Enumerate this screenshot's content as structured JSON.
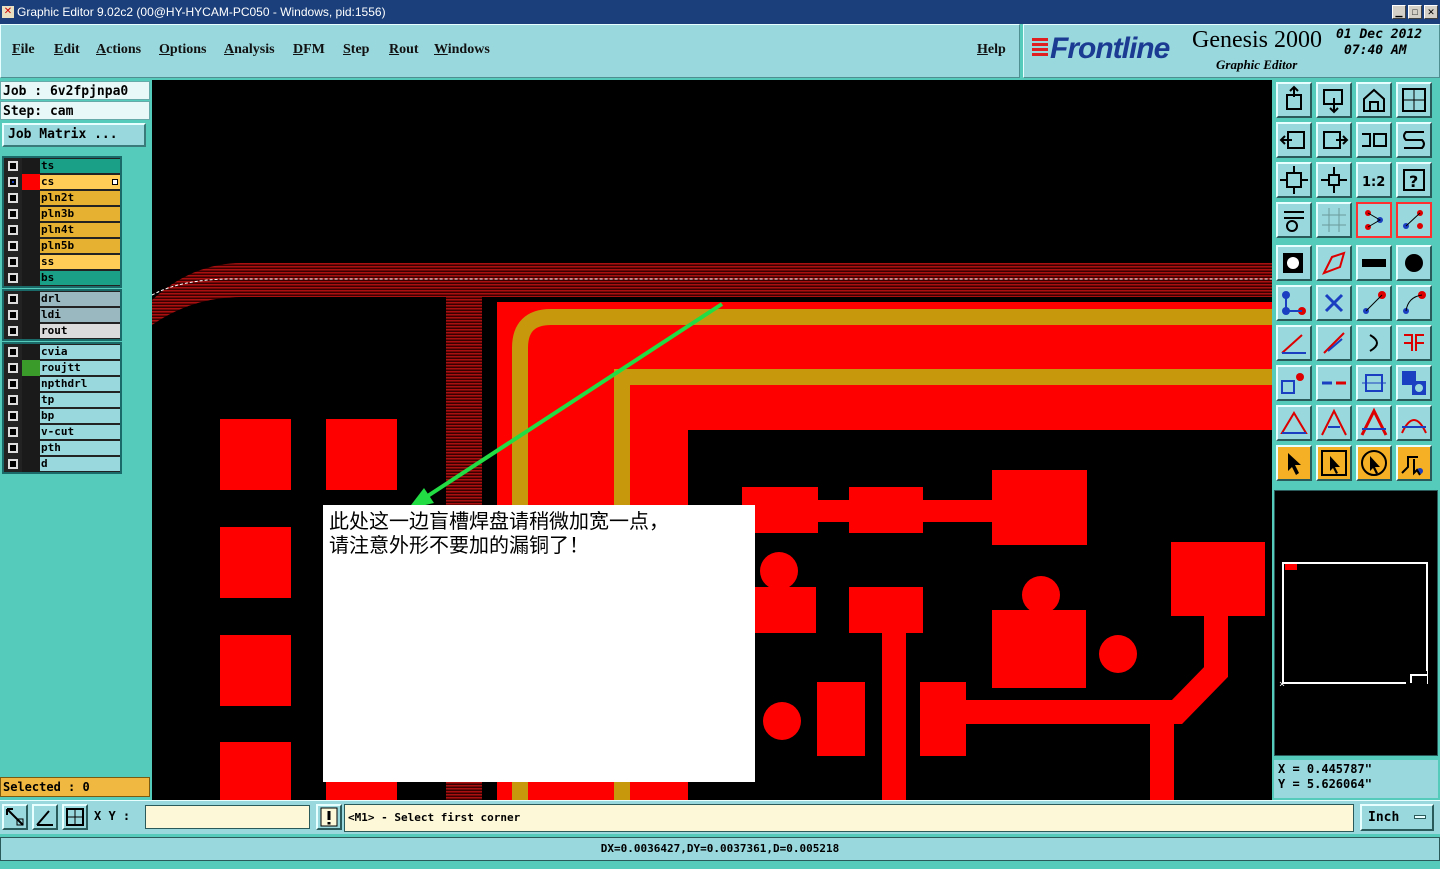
{
  "window": {
    "title": "Graphic Editor 9.02c2 (00@HY-HYCAM-PC050 - Windows, pid:1556)"
  },
  "menu": {
    "file": "File",
    "edit": "Edit",
    "actions": "Actions",
    "options": "Options",
    "analysis": "Analysis",
    "dfm": "DFM",
    "step": "Step",
    "rout": "Rout",
    "windows": "Windows",
    "help": "Help"
  },
  "brand": {
    "logo": "Frontline",
    "product": "Genesis 2000",
    "subtitle": "Graphic Editor",
    "date": "01 Dec 2012",
    "time": "07:40 AM"
  },
  "job": {
    "job_line": "Job : 6v2fpjnpa0",
    "step_line": "Step: cam",
    "matrix_button": "Job Matrix ..."
  },
  "layers": {
    "board": [
      {
        "name": "ts",
        "color": "#1aa087",
        "swatch": "#1a1a1a",
        "checked": false
      },
      {
        "name": "cs",
        "color": "#ffcc55",
        "swatch": "#ff0000",
        "checked": true
      },
      {
        "name": "pln2t",
        "color": "#e6b030",
        "swatch": "#1a1a1a",
        "checked": false
      },
      {
        "name": "pln3b",
        "color": "#e6b030",
        "swatch": "#1a1a1a",
        "checked": false
      },
      {
        "name": "pln4t",
        "color": "#e6b030",
        "swatch": "#1a1a1a",
        "checked": false
      },
      {
        "name": "pln5b",
        "color": "#e6b030",
        "swatch": "#1a1a1a",
        "checked": false
      },
      {
        "name": "ss",
        "color": "#ffcc55",
        "swatch": "#1a1a1a",
        "checked": false
      },
      {
        "name": "bs",
        "color": "#1aa087",
        "swatch": "#1a1a1a",
        "checked": false
      }
    ],
    "drill": [
      {
        "name": "drl",
        "color": "#99b8c0",
        "swatch": "#1a1a1a",
        "checked": false
      },
      {
        "name": "ldi",
        "color": "#99b8c0",
        "swatch": "#1a1a1a",
        "checked": false
      },
      {
        "name": "rout",
        "color": "#dcdcdc",
        "swatch": "#1a1a1a",
        "checked": false
      }
    ],
    "misc": [
      {
        "name": "cvia",
        "color": "#99d8dd",
        "swatch": "#1a1a1a",
        "checked": false
      },
      {
        "name": "roujtt",
        "color": "#99d8dd",
        "swatch": "#3a9a2a",
        "checked": false
      },
      {
        "name": "npthdrl",
        "color": "#99d8dd",
        "swatch": "#1a1a1a",
        "checked": false
      },
      {
        "name": "tp",
        "color": "#99d8dd",
        "swatch": "#1a1a1a",
        "checked": false
      },
      {
        "name": "bp",
        "color": "#99d8dd",
        "swatch": "#1a1a1a",
        "checked": false
      },
      {
        "name": "v-cut",
        "color": "#99d8dd",
        "swatch": "#1a1a1a",
        "checked": false
      },
      {
        "name": "pth",
        "color": "#99d8dd",
        "swatch": "#1a1a1a",
        "checked": false
      },
      {
        "name": "d",
        "color": "#99d8dd",
        "swatch": "#1a1a1a",
        "checked": false
      }
    ]
  },
  "selected": "Selected : 0",
  "annotation": {
    "line1": "此处这一边盲槽焊盘请稍微加宽一点，",
    "line2": "请注意外形不要加的漏铜了！"
  },
  "coords": {
    "x": "X = 0.445787\"",
    "y": "Y = 5.626064\""
  },
  "bottom": {
    "xy_label": "X Y :",
    "xy_value": "",
    "prompt": "<M1> - Select first corner",
    "unit": "Inch"
  },
  "status": "DX=0.0036427,DY=0.0037361,D=0.005218",
  "colors": {
    "copper": "#ff0000",
    "outline": "#c8980c",
    "background": "#000000",
    "arrow": "#22dd44",
    "panel": "#55ccbb"
  }
}
